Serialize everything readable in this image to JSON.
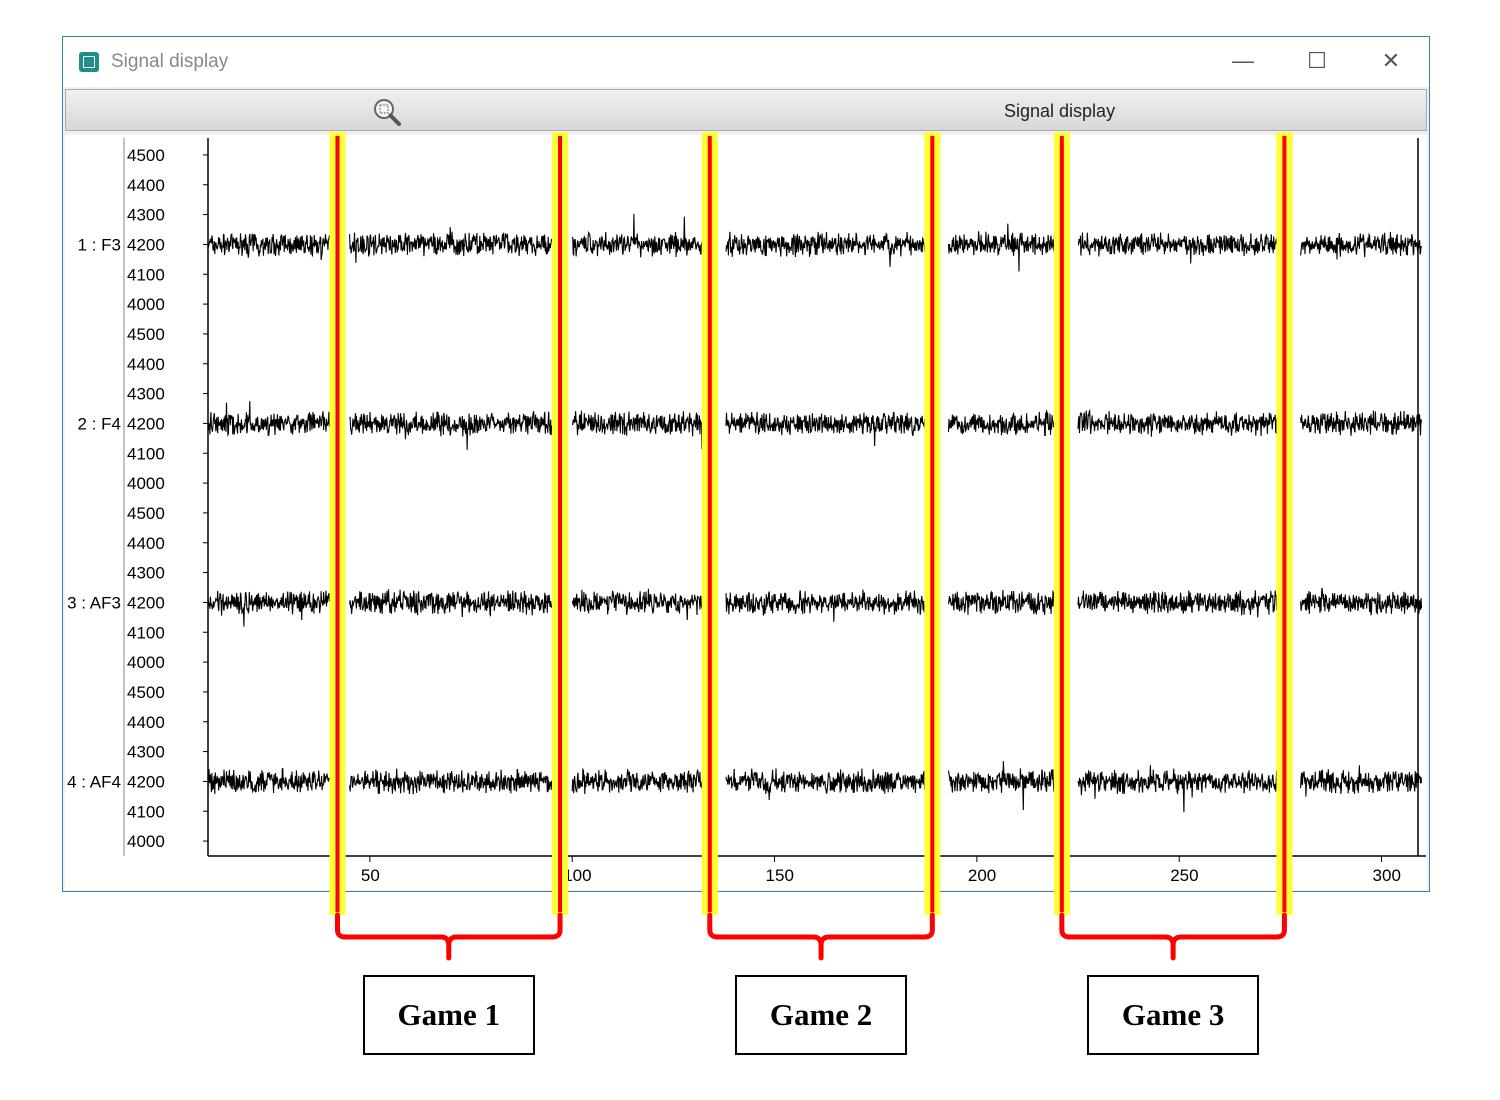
{
  "window": {
    "title": "Signal display",
    "icons": {
      "app": "signal-display-app-icon",
      "minimize": "minimize-icon",
      "maximize": "maximize-icon",
      "close": "close-icon"
    },
    "minimize_glyph": "—",
    "maximize_glyph": "☐",
    "close_glyph": "✕"
  },
  "toolbar": {
    "zoom_icon": "zoom-magnifier-icon",
    "label": "Signal display"
  },
  "chart_data": {
    "type": "line",
    "title": "",
    "xlabel": "",
    "ylabel": "",
    "xlim": [
      10,
      310
    ],
    "x_ticks": [
      "50",
      "100",
      "150",
      "200",
      "250",
      "300"
    ],
    "channel_ylim": [
      3950,
      4550
    ],
    "channel_y_ticks": [
      "4500",
      "4400",
      "4300",
      "4200",
      "4100",
      "4000"
    ],
    "trace_color": "#000000",
    "grid": false,
    "series": [
      {
        "name": "1 : F3",
        "baseline": 4200
      },
      {
        "name": "2 : F4",
        "baseline": 4200
      },
      {
        "name": "3 : AF3",
        "baseline": 4200
      },
      {
        "name": "4 : AF4",
        "baseline": 4200
      }
    ],
    "gaps_x": [
      40,
      95,
      133,
      188,
      220,
      275,
      310
    ],
    "marker_color": "#ff0000",
    "marker_highlight": "#ffff33",
    "markers_x": [
      42,
      97,
      134,
      189,
      221,
      276
    ]
  },
  "annotations": {
    "bracket_color": "#ff0000",
    "games": [
      {
        "label": "Game 1",
        "x_start": 42,
        "x_end": 97
      },
      {
        "label": "Game 2",
        "x_start": 134,
        "x_end": 189
      },
      {
        "label": "Game 3",
        "x_start": 221,
        "x_end": 276
      }
    ]
  }
}
